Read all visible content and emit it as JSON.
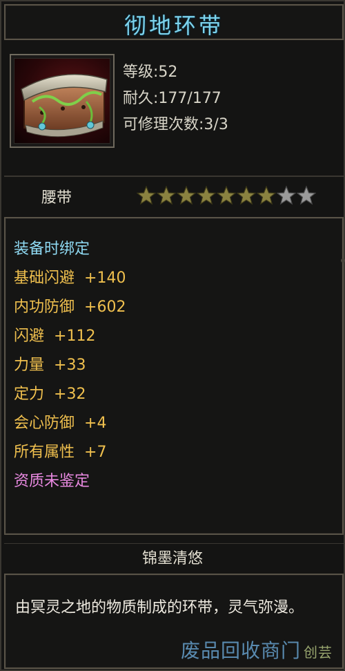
{
  "item": {
    "name": "彻地环带",
    "level": "等级:52",
    "durability": "耐久:177/177",
    "repair": "可修理次数:3/3",
    "type": "腰带",
    "stars_filled": 7,
    "stars_total": 9
  },
  "attributes": {
    "bind": "装备时绑定",
    "list": [
      {
        "name": "基础闪避",
        "value": "+140"
      },
      {
        "name": "内功防御",
        "value": "+602"
      },
      {
        "name": "闪避",
        "value": "+112"
      },
      {
        "name": "力量",
        "value": "+33"
      },
      {
        "name": "定力",
        "value": "+32"
      },
      {
        "name": "会心防御",
        "value": "+4"
      },
      {
        "name": "所有属性",
        "value": "+7"
      }
    ],
    "quality": "资质未鉴定"
  },
  "set_name": "锦墨清悠",
  "description": "由冥灵之地的物质制成的环带，灵气弥漫。",
  "watermark": {
    "main": "废品回收商门",
    "side": "创芸"
  },
  "icons": {
    "item_icon": "belt-icon",
    "star": "star-icon"
  },
  "colors": {
    "title": "#7dd3ec",
    "bind": "#8fd9f2",
    "attribute": "#f0c04e",
    "quality": "#e889e0",
    "star_filled": "#8a8240",
    "star_empty": "#9a9a9a"
  }
}
